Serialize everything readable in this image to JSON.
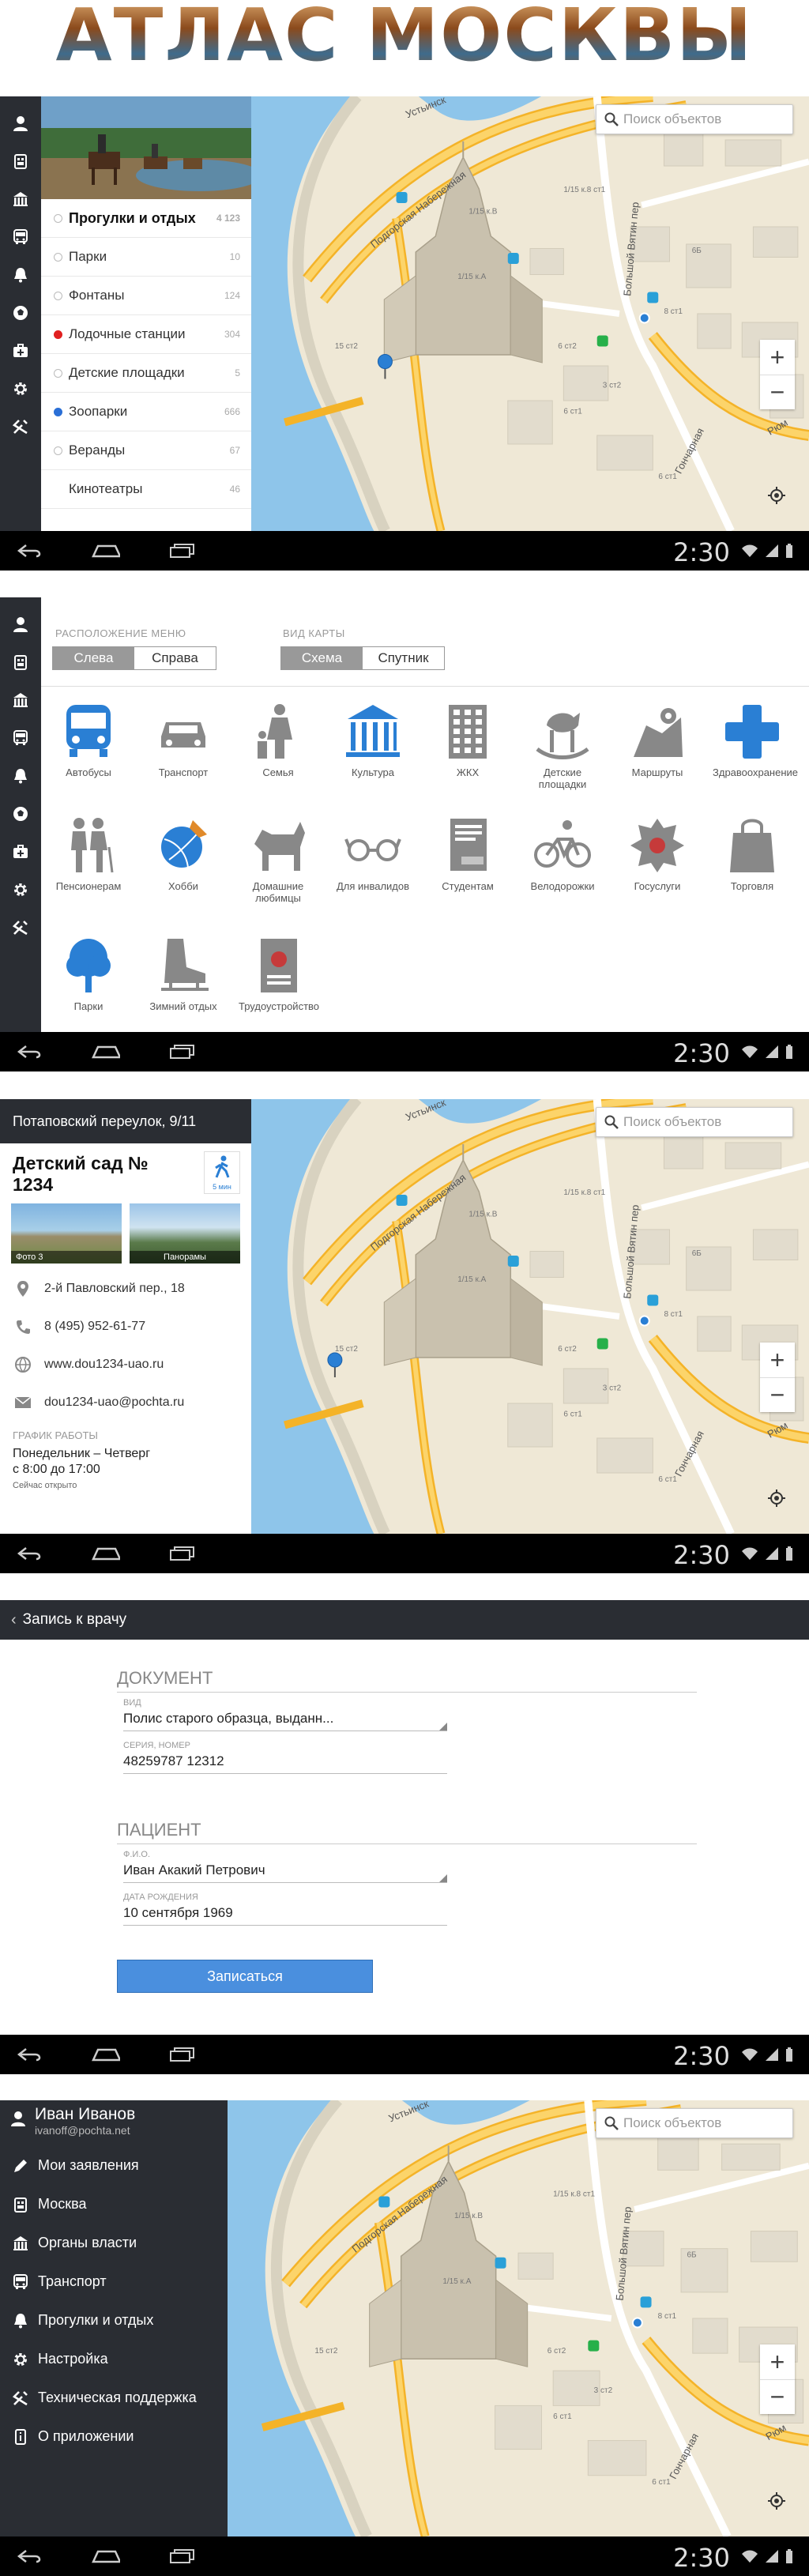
{
  "hero": {
    "title": "АТЛАС МОСКВЫ"
  },
  "common": {
    "clock": "2:30",
    "search_placeholder": "Поиск объектов",
    "zoom_in": "+",
    "zoom_out": "−"
  },
  "map_labels": {
    "street1": "Устьинск",
    "street2": "Подгорская Набережная",
    "street3": "Большой Вятин пер",
    "street4": "Гончарная",
    "street5": "Рюм",
    "house1": "1/15 к.8 ст1",
    "house2": "1/15 к.В",
    "house3": "1/15 к.А",
    "house4": "6 ст2",
    "house5": "6 ст1",
    "house6": "8 ст1",
    "house7": "6Б",
    "house8": "15 ст2",
    "house9": "6 ст1",
    "house10": "3 ст2"
  },
  "screen1": {
    "categories": [
      {
        "label": "Прогулки и отдых",
        "count": "4 123",
        "color": "#ffffff",
        "bold": true
      },
      {
        "label": "Парки",
        "count": "10",
        "color": "#ffffff",
        "bold": false
      },
      {
        "label": "Фонтаны",
        "count": "124",
        "color": "#ffffff",
        "bold": false
      },
      {
        "label": "Лодочные станции",
        "count": "304",
        "color": "#e02020",
        "bold": false
      },
      {
        "label": "Детские площадки",
        "count": "5",
        "color": "#ffffff",
        "bold": false
      },
      {
        "label": "Зоопарки",
        "count": "666",
        "color": "#2a6fd6",
        "bold": false
      },
      {
        "label": "Веранды",
        "count": "67",
        "color": "#ffffff",
        "bold": false
      },
      {
        "label": "Кинотеатры",
        "count": "46",
        "color": "none",
        "bold": false
      }
    ]
  },
  "screen2": {
    "menu_position_label": "РАСПОЛОЖЕНИЕ МЕНЮ",
    "menu_left": "Слева",
    "menu_right": "Справа",
    "map_type_label": "ВИД КАРТЫ",
    "map_scheme": "Схема",
    "map_satellite": "Спутник",
    "tiles": [
      {
        "label": "Автобусы",
        "icon": "bus-icon",
        "color": "#2a7fd4"
      },
      {
        "label": "Транспорт",
        "icon": "car-icon",
        "color": "#888888"
      },
      {
        "label": "Семья",
        "icon": "family-icon",
        "color": "#888888"
      },
      {
        "label": "Культура",
        "icon": "museum-icon",
        "color": "#2a7fd4"
      },
      {
        "label": "ЖКХ",
        "icon": "building-icon",
        "color": "#888888"
      },
      {
        "label": "Детские площадки",
        "icon": "rocking-horse-icon",
        "color": "#888888"
      },
      {
        "label": "Маршруты",
        "icon": "route-icon",
        "color": "#888888"
      },
      {
        "label": "Здравоохранение",
        "icon": "medical-cross-icon",
        "color": "#2a7fd4"
      },
      {
        "label": "Пенсионерам",
        "icon": "elderly-icon",
        "color": "#888888"
      },
      {
        "label": "Хобби",
        "icon": "hobby-icon",
        "color": "#2a7fd4"
      },
      {
        "label": "Домашние любимцы",
        "icon": "dog-icon",
        "color": "#888888"
      },
      {
        "label": "Для инвалидов",
        "icon": "glasses-icon",
        "color": "#888888"
      },
      {
        "label": "Студентам",
        "icon": "book-icon",
        "color": "#888888"
      },
      {
        "label": "Велодорожки",
        "icon": "bicycle-icon",
        "color": "#888888"
      },
      {
        "label": "Госуслуги",
        "icon": "emblem-icon",
        "color": "#888888"
      },
      {
        "label": "Торговля",
        "icon": "shopping-bag-icon",
        "color": "#888888"
      },
      {
        "label": "Парки",
        "icon": "tree-icon",
        "color": "#2a7fd4"
      },
      {
        "label": "Зимний отдых",
        "icon": "skate-icon",
        "color": "#888888"
      },
      {
        "label": "Трудоустройство",
        "icon": "passport-icon",
        "color": "#888888"
      }
    ]
  },
  "screen3": {
    "address_header": "Потаповский переулок, 9/11",
    "title": "Детский сад № 1234",
    "walk_time": "5 мин",
    "photo1_label": "Фото 3",
    "photo2_label": "Панорамы",
    "address": "2-й Павловский пер., 18",
    "phone": "8 (495) 952-61-77",
    "website": "www.dou1234-uao.ru",
    "email": "dou1234-uao@pochta.ru",
    "schedule_label": "ГРАФИК РАБОТЫ",
    "schedule_days": "Понедельник – Четверг",
    "schedule_hours": "с 8:00 до 17:00",
    "status": "Сейчас открыто"
  },
  "screen4": {
    "header": "Запись к врачу",
    "doc_section": "ДОКУМЕНТ",
    "doc_type_label": "ВИД",
    "doc_type_value": "Полис старого образца, выданн...",
    "doc_number_label": "СЕРИЯ, НОМЕР",
    "doc_number_value": "48259787 12312",
    "patient_section": "ПАЦИЕНТ",
    "fio_label": "Ф.И.О.",
    "fio_value": "Иван Акакий Петрович",
    "dob_label": "ДАТА РОЖДЕНИЯ",
    "dob_value": "10 сентября 1969",
    "submit": "Записаться"
  },
  "screen5": {
    "user_name": "Иван Иванов",
    "user_email": "ivanoff@pochta.net",
    "menu": [
      {
        "label": "Мои заявления",
        "icon": "pen-icon"
      },
      {
        "label": "Москва",
        "icon": "city-icon"
      },
      {
        "label": "Органы власти",
        "icon": "government-icon"
      },
      {
        "label": "Транспорт",
        "icon": "bus-icon"
      },
      {
        "label": "Прогулки и отдых",
        "icon": "bell-icon"
      },
      {
        "label": "Настройка",
        "icon": "gear-icon"
      },
      {
        "label": "Техническая поддержка",
        "icon": "tools-icon"
      },
      {
        "label": "О приложении",
        "icon": "info-icon"
      }
    ]
  }
}
